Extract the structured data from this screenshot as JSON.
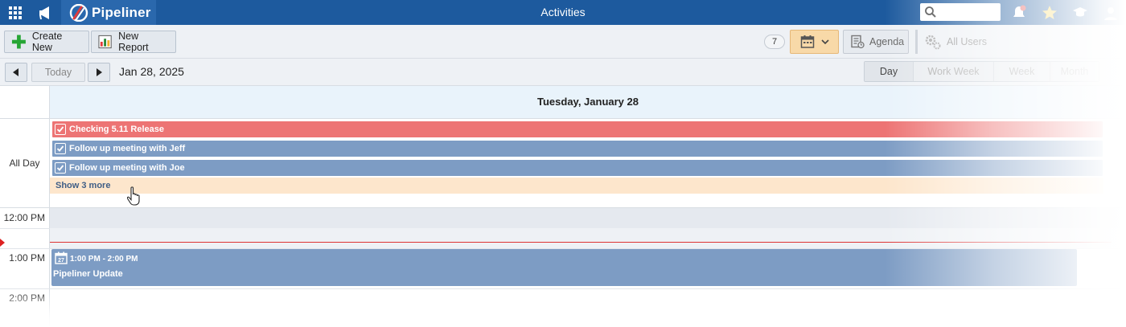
{
  "header": {
    "app_name": "Pipeliner",
    "title": "Activities"
  },
  "toolbar": {
    "create_new": "Create New",
    "new_report": "New Report",
    "count_badge": "7",
    "agenda": "Agenda",
    "all_users": "All Users"
  },
  "nav": {
    "today": "Today",
    "date": "Jan 28, 2025",
    "views": [
      "Day",
      "Work Week",
      "Week",
      "Month"
    ],
    "active_view": "Day"
  },
  "calendar": {
    "day_header": "Tuesday, January 28",
    "all_day_label": "All Day",
    "all_day_events": [
      {
        "title": "Checking 5.11 Release",
        "color": "#ed7474"
      },
      {
        "title": "Follow up meeting with Jeff",
        "color": "#7d9cc4"
      },
      {
        "title": "Follow up meeting with Joe",
        "color": "#7d9cc4"
      }
    ],
    "show_more": "Show 3 more",
    "times": [
      "12:00 PM",
      "1:00 PM",
      "2:00 PM"
    ],
    "timed_event": {
      "time": "1:00 PM - 2:00 PM",
      "title": "Pipeliner Update",
      "icon_day": "27"
    }
  },
  "colors": {
    "topbar": "#1d5a9e",
    "accent_orange": "#f8d9a8",
    "event_blue": "#7d9cc4",
    "event_red": "#ed7474",
    "now_line": "#d33333"
  }
}
